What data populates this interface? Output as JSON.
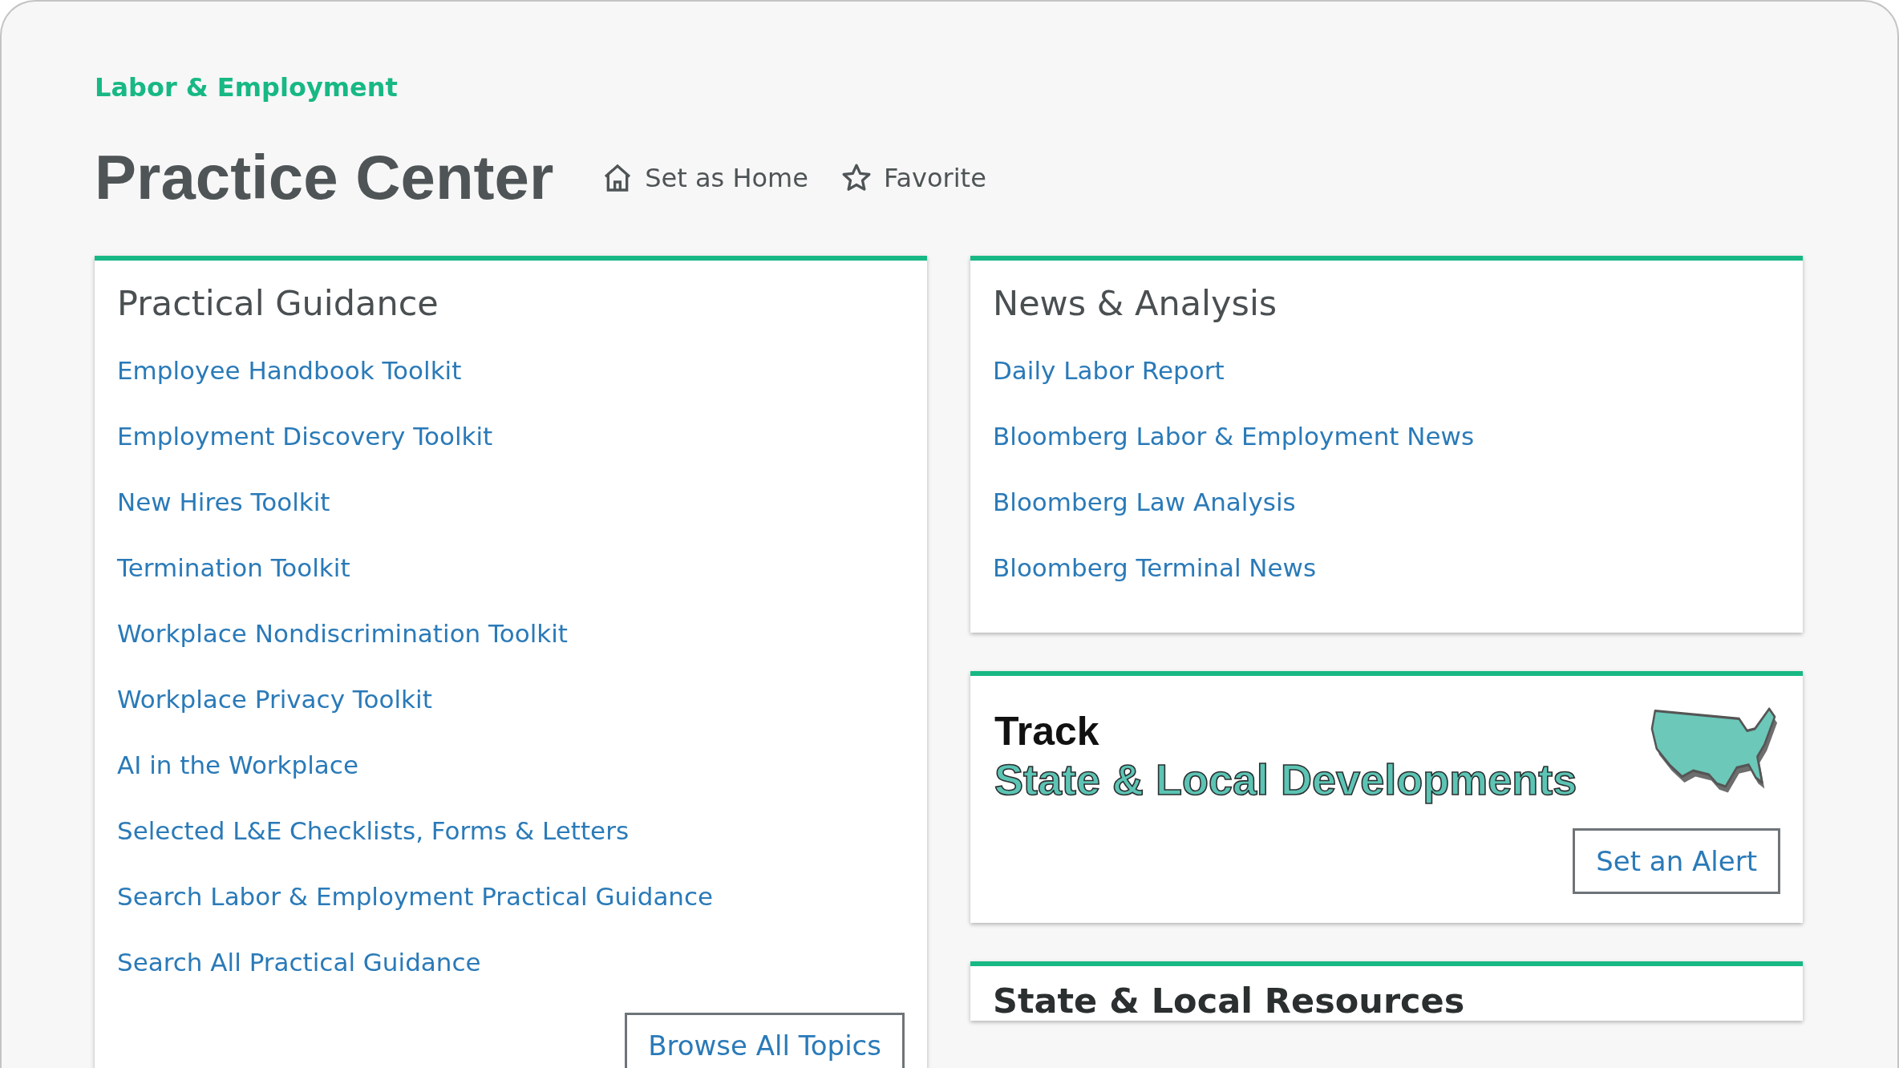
{
  "header": {
    "section": "Labor & Employment",
    "title": "Practice Center",
    "actions": [
      {
        "label": "Set as Home",
        "kind": "home"
      },
      {
        "label": "Favorite",
        "kind": "star"
      }
    ]
  },
  "practical_guidance": {
    "title": "Practical Guidance",
    "links": [
      "Employee Handbook Toolkit",
      "Employment Discovery Toolkit",
      "New Hires Toolkit",
      "Termination Toolkit",
      "Workplace Nondiscrimination Toolkit",
      "Workplace Privacy Toolkit",
      "AI in the Workplace",
      "Selected L&E Checklists, Forms & Letters",
      "Search Labor & Employment Practical Guidance",
      "Search All Practical Guidance"
    ],
    "button": "Browse All Topics"
  },
  "news_analysis": {
    "title": "News & Analysis",
    "links": [
      "Daily Labor Report",
      "Bloomberg Labor & Employment News",
      "Bloomberg Law Analysis",
      "Bloomberg Terminal News"
    ]
  },
  "track": {
    "heading": "Track",
    "subheading": "State & Local Developments",
    "button": "Set an Alert"
  },
  "resources": {
    "title": "State & Local Resources"
  }
}
